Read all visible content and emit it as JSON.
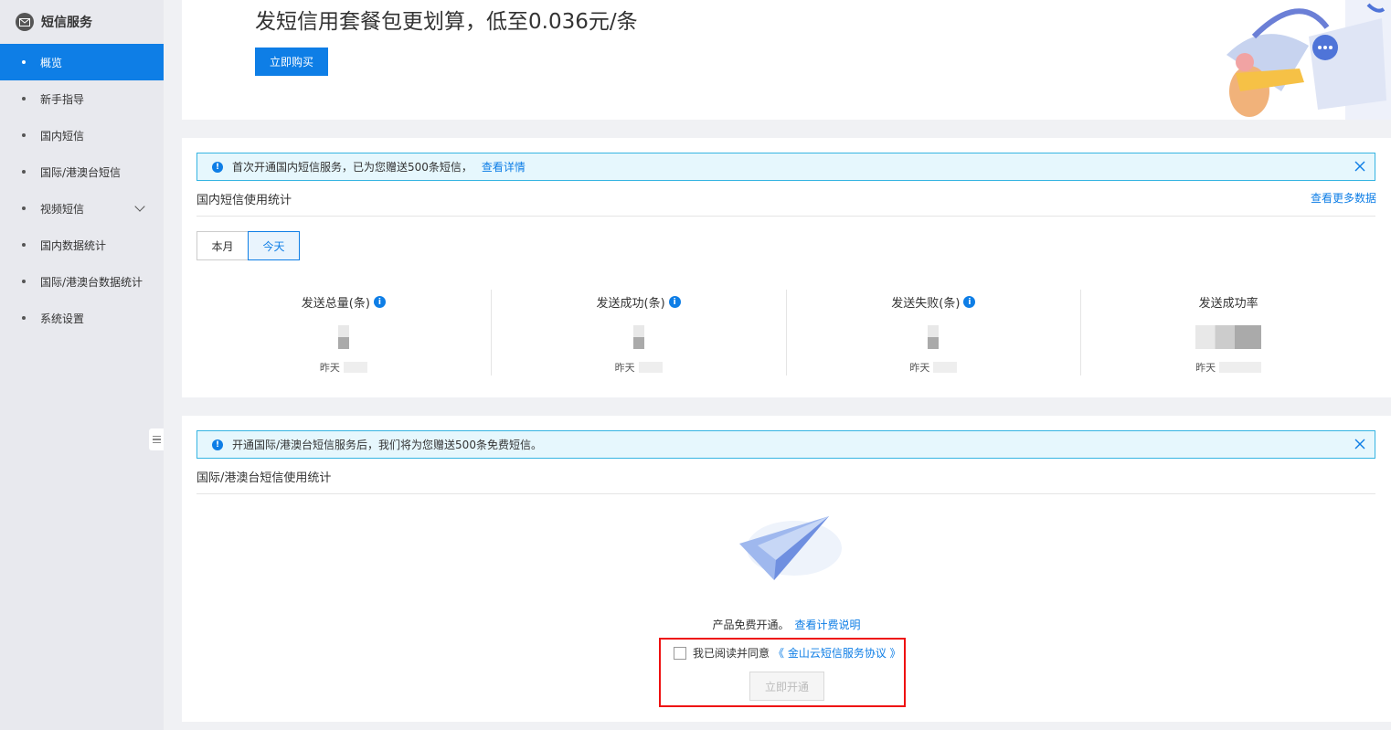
{
  "sidebar": {
    "title": "短信服务",
    "items": [
      {
        "label": "概览",
        "active": true
      },
      {
        "label": "新手指导"
      },
      {
        "label": "国内短信"
      },
      {
        "label": "国际/港澳台短信"
      },
      {
        "label": "视频短信",
        "expandable": true
      },
      {
        "label": "国内数据统计"
      },
      {
        "label": "国际/港澳台数据统计"
      },
      {
        "label": "系统设置"
      }
    ]
  },
  "banner": {
    "title": "发短信用套餐包更划算，低至0.036元/条",
    "button": "立即购买"
  },
  "domestic": {
    "notice_text": "首次开通国内短信服务，已为您赠送500条短信，",
    "notice_link": "查看详情",
    "title": "国内短信使用统计",
    "more_link": "查看更多数据",
    "tabs": [
      "本月",
      "今天"
    ],
    "active_tab": "今天",
    "stats": [
      {
        "label": "发送总量(条)",
        "yday": "昨天"
      },
      {
        "label": "发送成功(条)",
        "yday": "昨天"
      },
      {
        "label": "发送失败(条)",
        "yday": "昨天"
      },
      {
        "label": "发送成功率",
        "yday": "昨天"
      }
    ]
  },
  "intl": {
    "notice_text": "开通国际/港澳台短信服务后，我们将为您赠送500条免费短信。",
    "title": "国际/港澳台短信使用统计",
    "free_text": "产品免费开通。",
    "free_link": "查看计费说明",
    "agree_text": "我已阅读并同意",
    "agree_link": "《 金山云短信服务协议 》",
    "open_button": "立即开通"
  },
  "colors": {
    "accent": "#0e7ee6",
    "highlight_border": "#e11111"
  }
}
